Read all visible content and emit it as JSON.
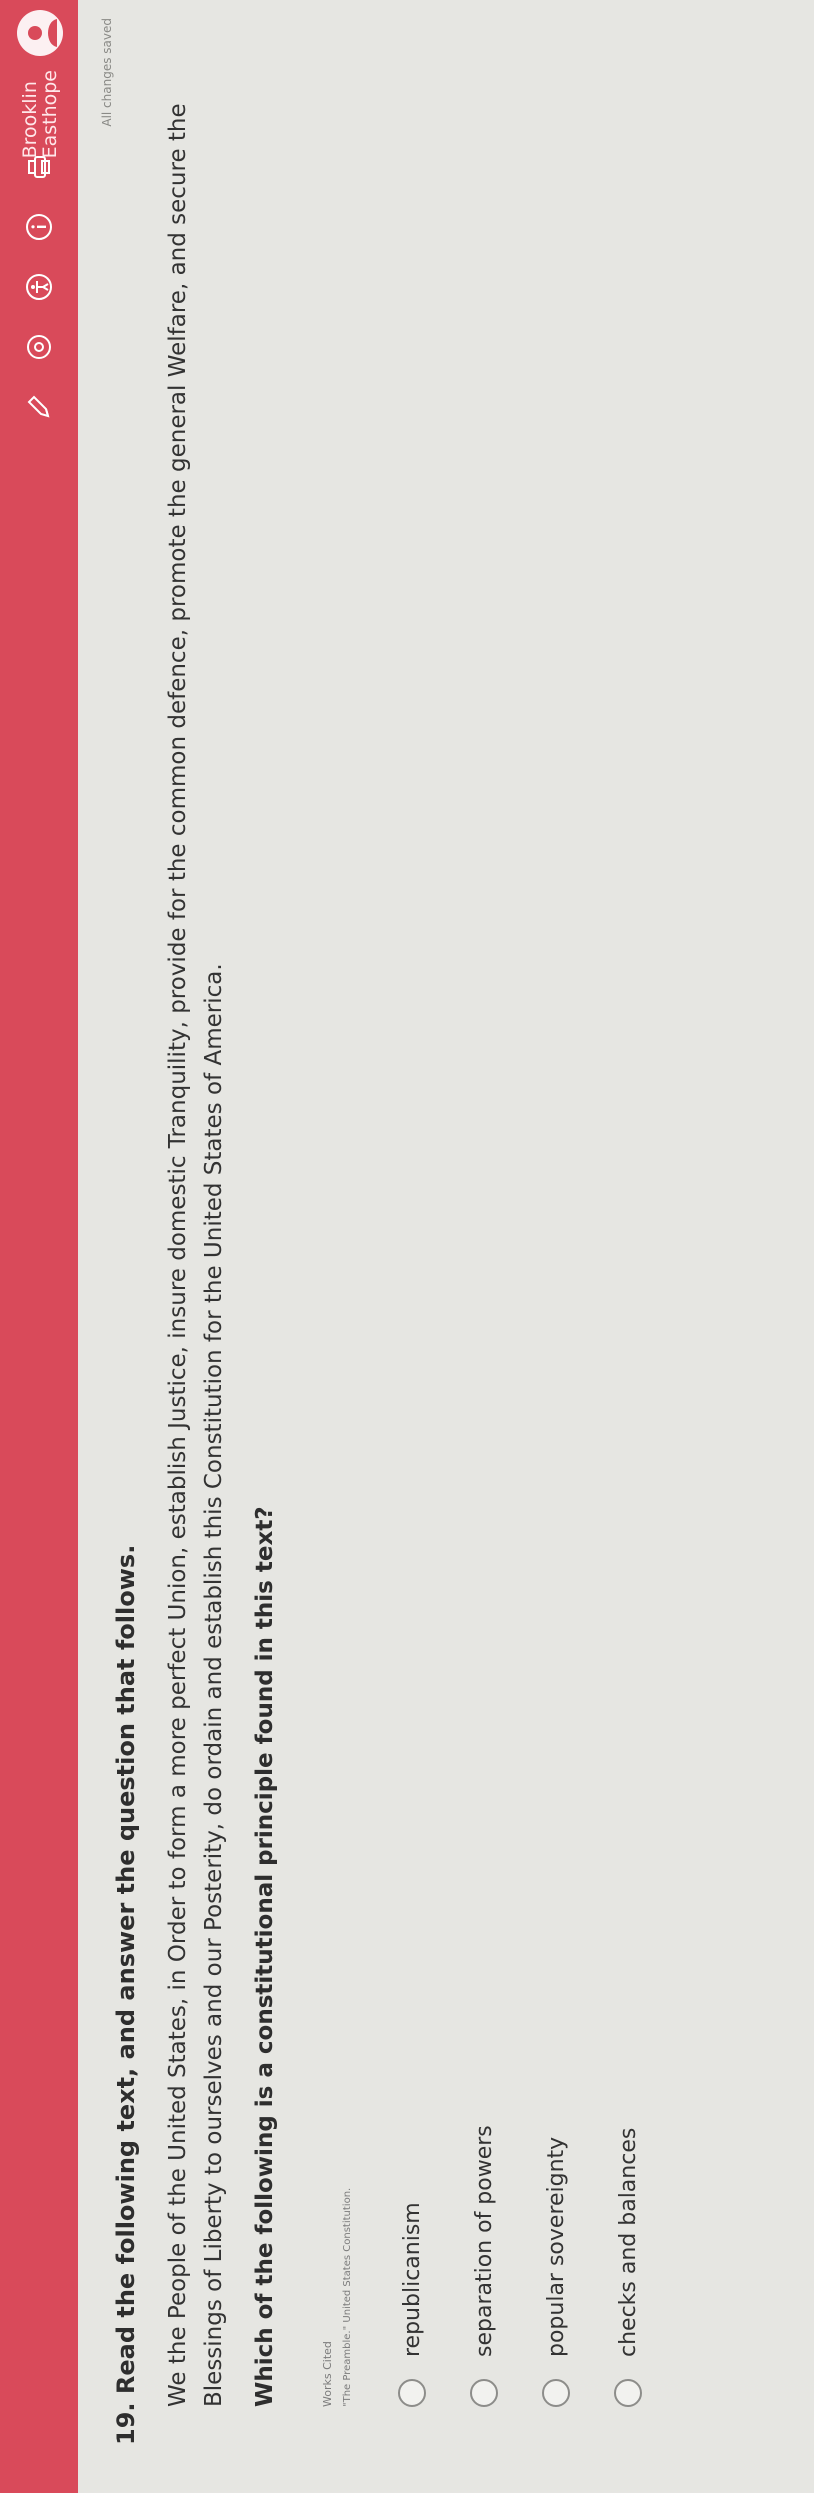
{
  "header": {
    "user_first": "Brooklin",
    "user_last": "Easthope",
    "saved_status": "All changes saved",
    "colors": {
      "bar": "#d94a5a",
      "icon": "#ffffff"
    },
    "icons": [
      "pencil-icon",
      "target-icon",
      "accessibility-icon",
      "info-icon",
      "printer-icon"
    ]
  },
  "question": {
    "number_title": "19. Read the following text, and answer the question that follows.",
    "passage": "We the People of the United States, in Order to form a more perfect Union, establish Justice, insure domestic Tranquility, provide for the common defence, promote the general Welfare, and secure the Blessings of Liberty to ourselves and our Posterity, do ordain and establish this Constitution for the United States of America.",
    "prompt": "Which of the following is a constitutional principle found in this text?",
    "works_cited_label": "Works Cited",
    "citation": "\"The Preamble.\" United States Constitution.",
    "options": [
      {
        "label": "republicanism"
      },
      {
        "label": "separation of powers"
      },
      {
        "label": "popular sovereignty"
      },
      {
        "label": "checks and balances"
      }
    ]
  }
}
